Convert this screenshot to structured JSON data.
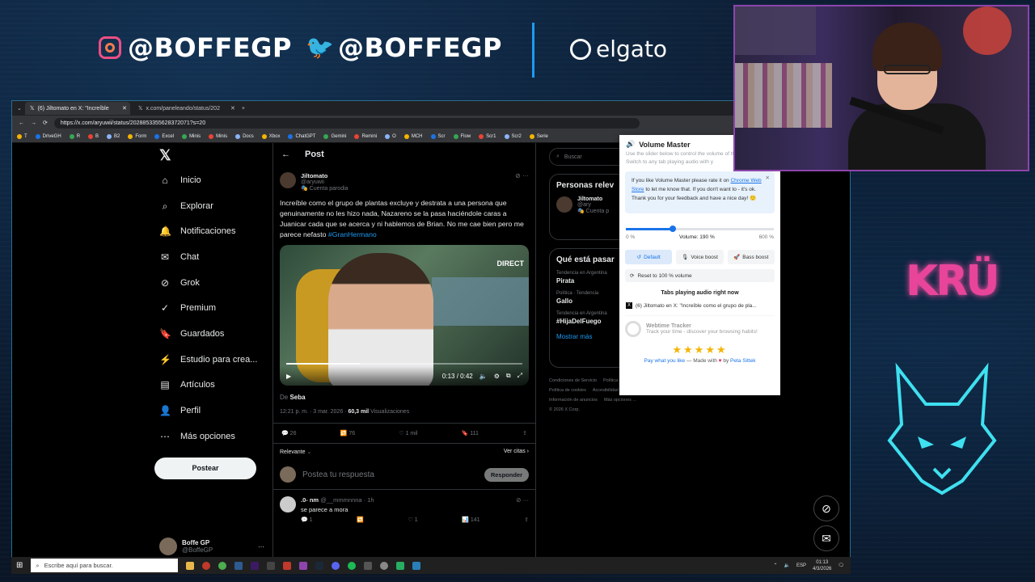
{
  "overlay": {
    "instagram_handle": "@BOFFEGP",
    "twitter_handle": "@BOFFEGP",
    "sponsor": "elgato",
    "team_logo": "KRÜ"
  },
  "browser": {
    "tabs": [
      {
        "title": "(6) Jiltomato en X: \"Increíble",
        "favicon": "x-icon",
        "active": true
      },
      {
        "title": "x.com/paneleando/status/202",
        "favicon": "x-icon",
        "active": false
      }
    ],
    "url": "https://x.com/aryuwii/status/2028853355628372071?s=20",
    "bookmarks": [
      "T",
      "DriveGH",
      "R",
      "B",
      "B2",
      "Form",
      "Excel",
      "Minis",
      "Minis",
      "Docs",
      "Xbox",
      "ChatGPT",
      "Gemini",
      "Remini",
      "O",
      "MCH",
      "Scr",
      "Flow",
      "Scr1",
      "Scr2",
      "Serie"
    ]
  },
  "nav": {
    "items": [
      {
        "label": "Inicio",
        "icon": "home-icon"
      },
      {
        "label": "Explorar",
        "icon": "search-icon"
      },
      {
        "label": "Notificaciones",
        "icon": "bell-icon"
      },
      {
        "label": "Chat",
        "icon": "mail-icon"
      },
      {
        "label": "Grok",
        "icon": "grok-icon"
      },
      {
        "label": "Premium",
        "icon": "premium-icon"
      },
      {
        "label": "Guardados",
        "icon": "bookmark-icon"
      },
      {
        "label": "Estudio para crea...",
        "icon": "studio-icon"
      },
      {
        "label": "Artículos",
        "icon": "article-icon"
      },
      {
        "label": "Perfil",
        "icon": "person-icon"
      },
      {
        "label": "Más opciones",
        "icon": "more-icon"
      }
    ],
    "post_button": "Postear",
    "profile": {
      "name": "Boffe GP",
      "handle": "@BoffeGP"
    }
  },
  "post": {
    "header": "Post",
    "author": "Jiltomato",
    "handle": "@aryuwii",
    "badge": "Cuenta parodia",
    "text": "Increíble como el grupo de plantas excluye y destrata a una persona que genuinamente no les hizo nada, Nazareno se la pasa haciéndole caras a Juanicar cada que se acerca y ni hablemos de Brian. No me cae bien pero me parece nefasto ",
    "hashtag": "#GranHermano",
    "video": {
      "time": "0:13 / 0:42",
      "progress": 0.31,
      "overlay": "DIRECT"
    },
    "from_label": "De",
    "from": "Seba",
    "timestamp": "12:21 p. m. · 3 mar. 2026 · ",
    "views": "60,3 mil",
    "views_label": " Visualizaciones",
    "replies": "26",
    "reposts": "76",
    "likes": "1 mil",
    "bookmarks": "111",
    "sort": "Relevante",
    "quotes": "Ver citas",
    "reply_placeholder": "Postea tu respuesta",
    "reply_button": "Responder"
  },
  "comment": {
    "author": ".0- nm",
    "handle": "@__mmmnnna · 1h",
    "text": "se parece a mora",
    "replies": "1",
    "likes": "1",
    "views": "141"
  },
  "sidebar": {
    "search_placeholder": "Buscar",
    "people_title": "Personas relev",
    "person": {
      "name": "Jiltomato",
      "handle": "@ary",
      "badge": "Cuenta p"
    },
    "trends_title": "Qué está pasar",
    "trends": [
      {
        "context": "Tendencia en Argentina",
        "name": "Pirata"
      },
      {
        "context": "Política · Tendencia",
        "name": "Gallo"
      },
      {
        "context": "Tendencia en Argentina",
        "name": "#HijaDelFuego"
      }
    ],
    "show_more": "Mostrar más",
    "footer": [
      "Condiciones de Servicio",
      "Política de Privacidad",
      "Política de cookies",
      "Accesibilidad",
      "Información de anuncios",
      "Más opciones ...",
      "© 2026 X Corp."
    ]
  },
  "volume_master": {
    "title": "Volume Master",
    "subtitle": "Use the slider below to control the volume of the current tab. Switch to any tab playing audio with y",
    "note_pre": "If you like Volume Master please rate it on ",
    "note_link": "Chrome Web Store",
    "note_post": " to let me know that. If you don't want to - it's ok. Thank you for your feedback and have a nice day! 🙂",
    "min_label": "0 %",
    "volume_label": "Volume: 190 %",
    "max_label": "600 %",
    "volume_fraction": 0.3167,
    "modes": [
      "Default",
      "Voice boost",
      "Bass boost"
    ],
    "reset": "Reset to 100 % volume",
    "tabs_title": "Tabs playing audio right now",
    "tab_playing": "(6) Jiltomato en X: \"Increíble como el grupo de pla...",
    "ad_title": "Webtime Tracker",
    "ad_text": "Track your time - discover your browsing habits!",
    "stars": "★★★★★",
    "pay": "Pay what you like",
    "made_with": " — Made with ",
    "heart": "♥",
    "by": " by ",
    "author": "Peta Sittek"
  },
  "taskbar": {
    "search_placeholder": "Escribe aquí para buscar.",
    "language": "ESP",
    "time": "01:13",
    "date": "4/3/2026"
  }
}
